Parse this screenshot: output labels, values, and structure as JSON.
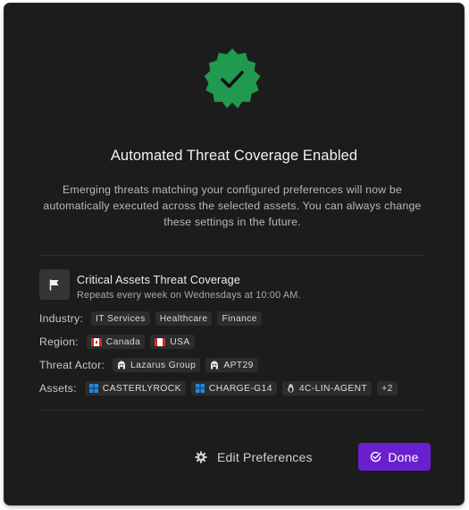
{
  "modal": {
    "title": "Automated Threat Coverage Enabled",
    "description": "Emerging threats matching your configured preferences will now be automatically executed across the selected assets. You can always change these settings in the future.",
    "success_color": "#1f9a4e"
  },
  "summary": {
    "icon": "flag-icon",
    "title": "Critical Assets Threat Coverage",
    "schedule": "Repeats every week on Wednesdays at 10:00 AM."
  },
  "details": {
    "industry": {
      "label": "Industry:",
      "chips": [
        "IT Services",
        "Healthcare",
        "Finance"
      ]
    },
    "region": {
      "label": "Region:",
      "chips": [
        {
          "label": "Canada",
          "icon": "canada-flag-icon"
        },
        {
          "label": "USA",
          "icon": "usa-flag-icon"
        }
      ]
    },
    "threat_actor": {
      "label": "Threat Actor:",
      "chips": [
        {
          "label": "Lazarus Group",
          "icon": "threat-actor-icon"
        },
        {
          "label": "APT29",
          "icon": "threat-actor-icon"
        }
      ]
    },
    "assets": {
      "label": "Assets:",
      "chips": [
        {
          "label": "CASTERLYROCK",
          "icon": "windows-icon"
        },
        {
          "label": "CHARGE-G14",
          "icon": "windows-icon"
        },
        {
          "label": "4C-LIN-AGENT",
          "icon": "linux-icon"
        }
      ],
      "more": "+2"
    }
  },
  "actions": {
    "edit_label": "Edit Preferences",
    "done_label": "Done",
    "done_color": "#6a1fcf"
  }
}
